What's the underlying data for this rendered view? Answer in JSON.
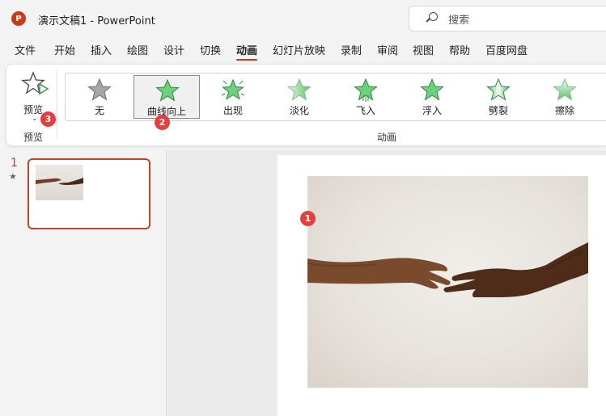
{
  "window": {
    "app_logo": "P",
    "title": "演示文稿1  -  PowerPoint"
  },
  "search": {
    "placeholder": "搜索"
  },
  "tabs": [
    {
      "label": "文件"
    },
    {
      "label": "开始"
    },
    {
      "label": "插入"
    },
    {
      "label": "绘图"
    },
    {
      "label": "设计"
    },
    {
      "label": "切换"
    },
    {
      "label": "动画"
    },
    {
      "label": "幻灯片放映"
    },
    {
      "label": "录制"
    },
    {
      "label": "审阅"
    },
    {
      "label": "视图"
    },
    {
      "label": "帮助"
    },
    {
      "label": "百度网盘"
    }
  ],
  "active_tab": "动画",
  "ribbon": {
    "preview": {
      "label": "预览",
      "group_label": "预览"
    },
    "animations_group_label": "动画",
    "effects": [
      {
        "label": "无",
        "style": "none"
      },
      {
        "label": "曲线向上",
        "style": "plain"
      },
      {
        "label": "出现",
        "style": "burst"
      },
      {
        "label": "淡化",
        "style": "fade"
      },
      {
        "label": "飞入",
        "style": "fly"
      },
      {
        "label": "浮入",
        "style": "plain"
      },
      {
        "label": "劈裂",
        "style": "split"
      },
      {
        "label": "擦除",
        "style": "wipe"
      }
    ],
    "selected_effect": "曲线向上"
  },
  "badges": {
    "photo": "1",
    "effect": "2",
    "preview": "3"
  },
  "thumbnails": [
    {
      "number": "1",
      "marker": "★"
    }
  ],
  "colors": {
    "accent": "#c43e1c",
    "star_green": "#5fbf6a",
    "badge_red": "#e43e3e"
  }
}
